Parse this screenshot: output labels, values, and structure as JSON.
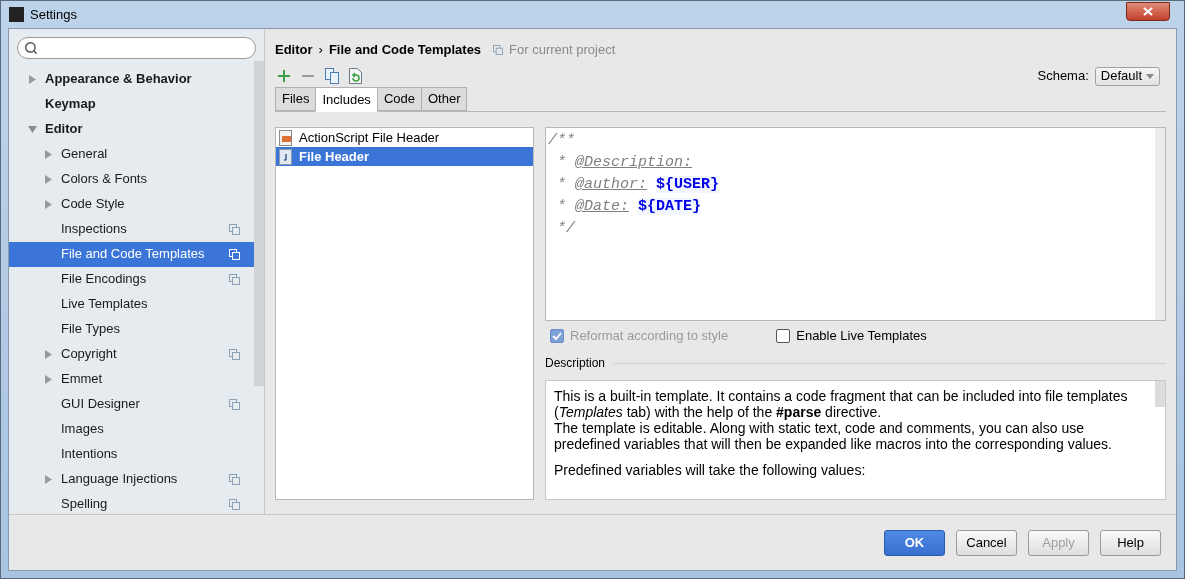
{
  "window": {
    "title": "Settings"
  },
  "sidebar": {
    "items": [
      {
        "label": "Appearance & Behavior",
        "bold": true,
        "expandable": true,
        "expanded": false,
        "selected": false,
        "project_scope": false
      },
      {
        "label": "Keymap",
        "bold": true,
        "expandable": false,
        "expanded": false,
        "selected": false,
        "project_scope": false
      },
      {
        "label": "Editor",
        "bold": true,
        "expandable": true,
        "expanded": true,
        "selected": false,
        "project_scope": false,
        "children": [
          {
            "label": "General",
            "bold": false,
            "expandable": true,
            "expanded": false,
            "selected": false,
            "project_scope": false
          },
          {
            "label": "Colors & Fonts",
            "bold": false,
            "expandable": true,
            "expanded": false,
            "selected": false,
            "project_scope": false
          },
          {
            "label": "Code Style",
            "bold": false,
            "expandable": true,
            "expanded": false,
            "selected": false,
            "project_scope": false
          },
          {
            "label": "Inspections",
            "bold": false,
            "expandable": false,
            "expanded": false,
            "selected": false,
            "project_scope": true
          },
          {
            "label": "File and Code Templates",
            "bold": false,
            "expandable": false,
            "expanded": false,
            "selected": true,
            "project_scope": true
          },
          {
            "label": "File Encodings",
            "bold": false,
            "expandable": false,
            "expanded": false,
            "selected": false,
            "project_scope": true
          },
          {
            "label": "Live Templates",
            "bold": false,
            "expandable": false,
            "expanded": false,
            "selected": false,
            "project_scope": false
          },
          {
            "label": "File Types",
            "bold": false,
            "expandable": false,
            "expanded": false,
            "selected": false,
            "project_scope": false
          },
          {
            "label": "Copyright",
            "bold": false,
            "expandable": true,
            "expanded": false,
            "selected": false,
            "project_scope": true
          },
          {
            "label": "Emmet",
            "bold": false,
            "expandable": true,
            "expanded": false,
            "selected": false,
            "project_scope": false
          },
          {
            "label": "GUI Designer",
            "bold": false,
            "expandable": false,
            "expanded": false,
            "selected": false,
            "project_scope": true
          },
          {
            "label": "Images",
            "bold": false,
            "expandable": false,
            "expanded": false,
            "selected": false,
            "project_scope": false
          },
          {
            "label": "Intentions",
            "bold": false,
            "expandable": false,
            "expanded": false,
            "selected": false,
            "project_scope": false
          },
          {
            "label": "Language Injections",
            "bold": false,
            "expandable": true,
            "expanded": false,
            "selected": false,
            "project_scope": true
          },
          {
            "label": "Spelling",
            "bold": false,
            "expandable": false,
            "expanded": false,
            "selected": false,
            "project_scope": true
          }
        ]
      }
    ]
  },
  "breadcrumb": {
    "parent": "Editor",
    "separator": "›",
    "current": "File and Code Templates",
    "scope": "For current project"
  },
  "toolbar": [
    {
      "kind": "add"
    },
    {
      "kind": "remove"
    },
    {
      "kind": "copy"
    },
    {
      "kind": "reset"
    }
  ],
  "schema": {
    "label": "Schema:",
    "value": "Default"
  },
  "tabs": [
    {
      "label": "Files",
      "selected": false
    },
    {
      "label": "Includes",
      "selected": true
    },
    {
      "label": "Code",
      "selected": false
    },
    {
      "label": "Other",
      "selected": false
    }
  ],
  "templates": [
    {
      "name": "ActionScript File Header",
      "kind": "actionscript",
      "selected": false
    },
    {
      "name": "File Header",
      "kind": "java",
      "selected": true
    }
  ],
  "editor": {
    "lines": [
      [
        {
          "kind": "comment",
          "text": "/**"
        }
      ],
      [
        {
          "kind": "comment",
          "text": " * "
        },
        {
          "kind": "tag",
          "text": "@Description:"
        }
      ],
      [
        {
          "kind": "comment",
          "text": " * "
        },
        {
          "kind": "tag",
          "text": "@author:"
        },
        {
          "kind": "var",
          "text": "${USER}"
        }
      ],
      [
        {
          "kind": "comment",
          "text": " * "
        },
        {
          "kind": "tag",
          "text": "@Date:"
        },
        {
          "kind": "var",
          "text": "${DATE}"
        }
      ],
      [
        {
          "kind": "comment",
          "text": " */"
        }
      ]
    ]
  },
  "options": [
    {
      "label": "Reformat according to style",
      "checked": true,
      "disabled": true
    },
    {
      "label": "Enable Live Templates",
      "checked": false,
      "disabled": false
    }
  ],
  "description": {
    "title": "Description",
    "blocks": [
      [
        "This is a built-in template. It contains a code fragment that can be included into file templates (*Templates* tab) with the help of the **#parse** directive.",
        "The template is editable. Along with static text, code and comments, you can also use predefined variables that will then be expanded like macros into the corresponding values."
      ],
      [
        "Predefined variables will take the following values:"
      ]
    ]
  },
  "buttons": [
    {
      "label": "OK",
      "primary": true,
      "disabled": false
    },
    {
      "label": "Cancel",
      "primary": false,
      "disabled": false
    },
    {
      "label": "Apply",
      "primary": false,
      "disabled": true
    },
    {
      "label": "Help",
      "primary": false,
      "disabled": false
    }
  ]
}
